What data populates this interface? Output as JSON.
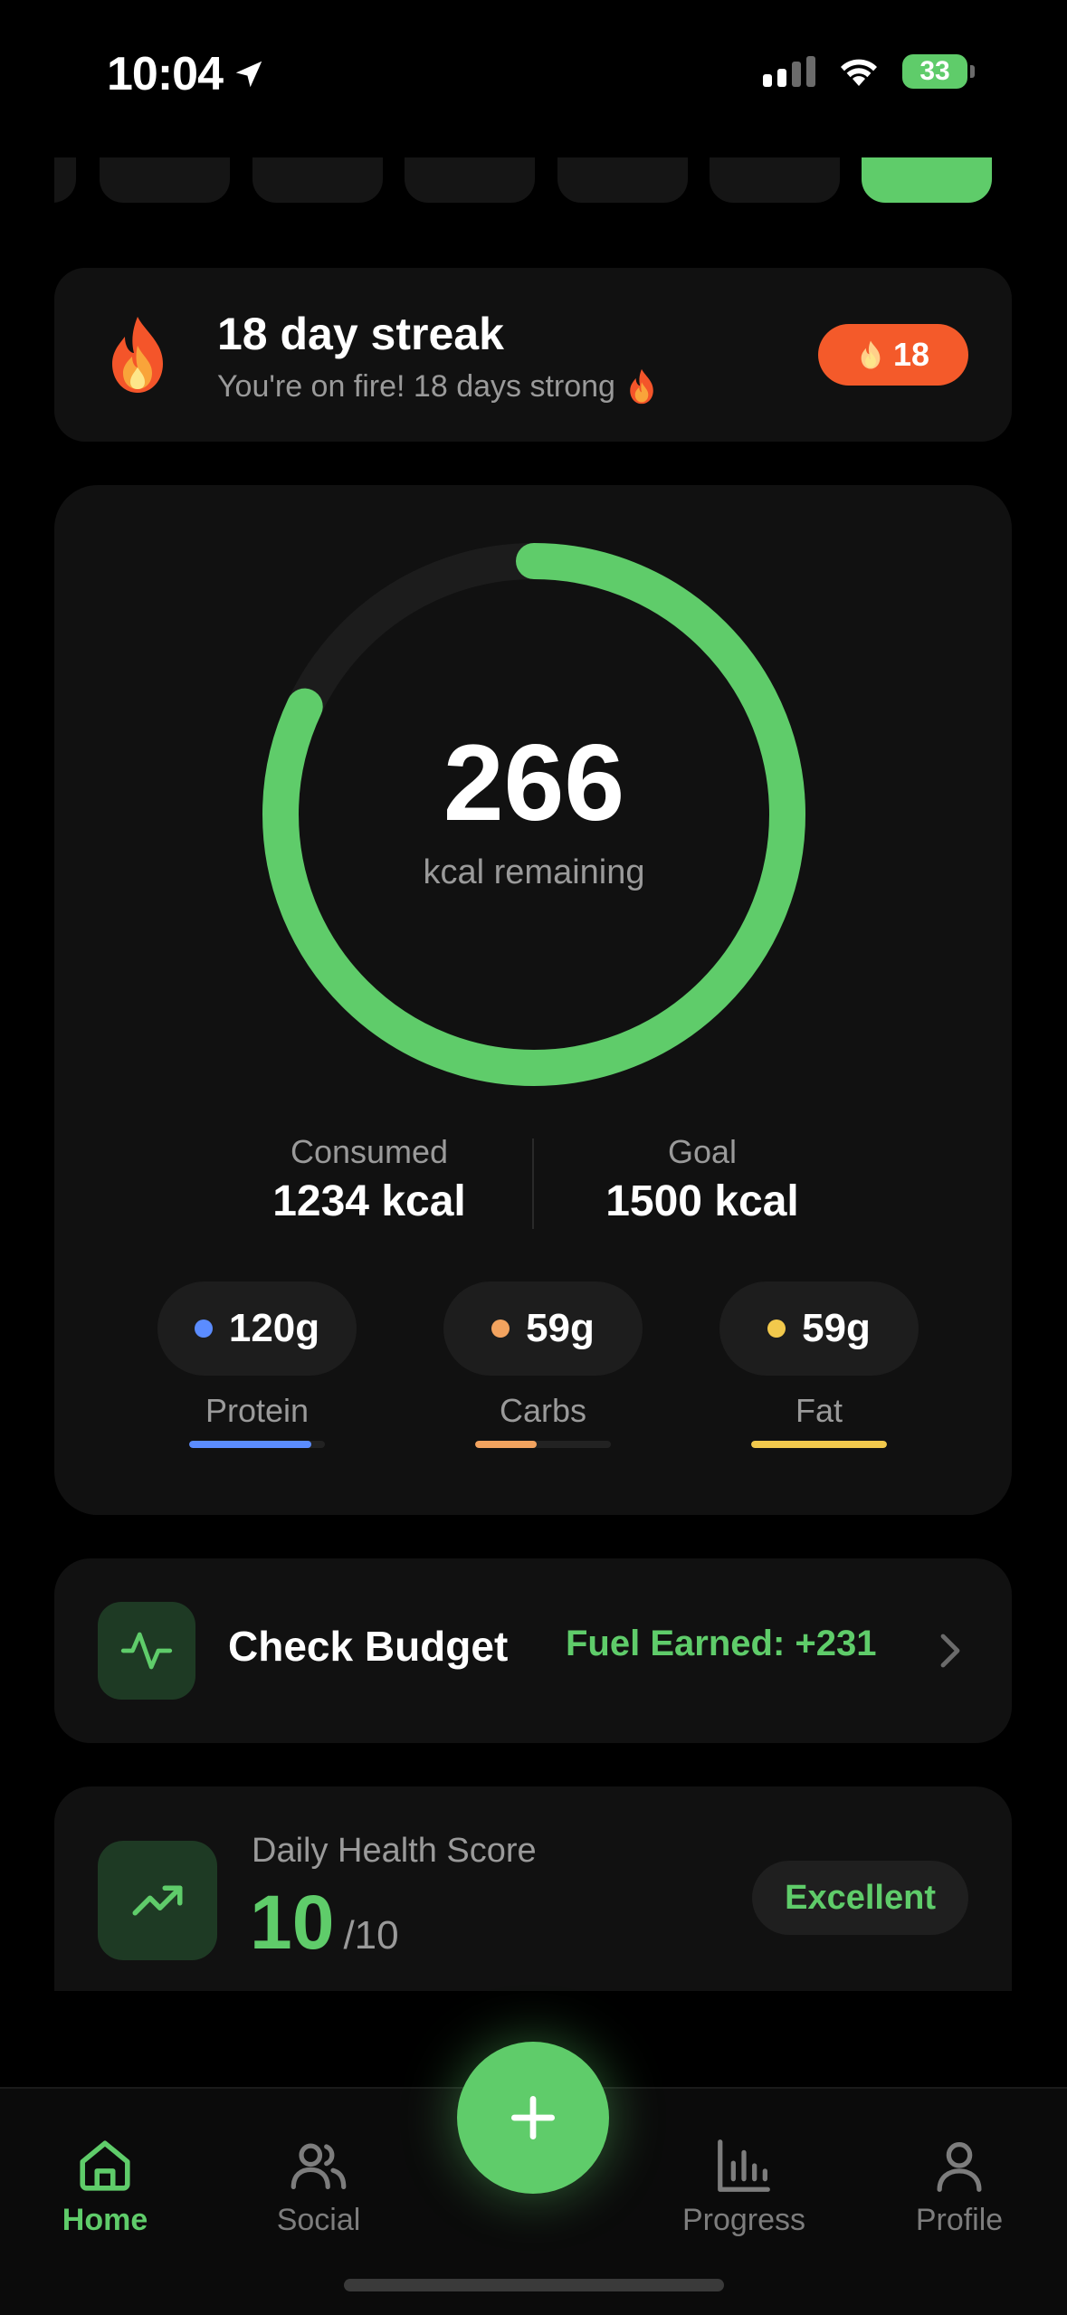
{
  "status": {
    "time": "10:04",
    "battery": "33"
  },
  "streak": {
    "title": "18 day streak",
    "subtitle": "You're on fire! 18 days strong",
    "badge": "18"
  },
  "calories": {
    "remaining": "266",
    "remaining_label": "kcal remaining",
    "consumed_label": "Consumed",
    "consumed_value": "1234 kcal",
    "goal_label": "Goal",
    "goal_value": "1500 kcal",
    "ring_progress": 0.82
  },
  "macros": [
    {
      "name": "Protein",
      "value": "120g",
      "color": "#5b8cff",
      "progress": 0.9
    },
    {
      "name": "Carbs",
      "value": "59g",
      "color": "#f2a35f",
      "progress": 0.45
    },
    {
      "name": "Fat",
      "value": "59g",
      "color": "#f2c94c",
      "progress": 1.0
    }
  ],
  "budget": {
    "title": "Check Budget",
    "fuel": "Fuel Earned: +231"
  },
  "health": {
    "label": "Daily Health Score",
    "score": "10",
    "max": "/10",
    "rating": "Excellent"
  },
  "tabs": {
    "home": "Home",
    "social": "Social",
    "progress": "Progress",
    "profile": "Profile"
  },
  "colors": {
    "accent": "#5fcc6a",
    "streak_badge": "#f45a2a"
  },
  "icons": {
    "streak": "flame-icon",
    "budget": "pulse-icon",
    "health": "trending-up-icon",
    "fab": "plus-icon"
  }
}
